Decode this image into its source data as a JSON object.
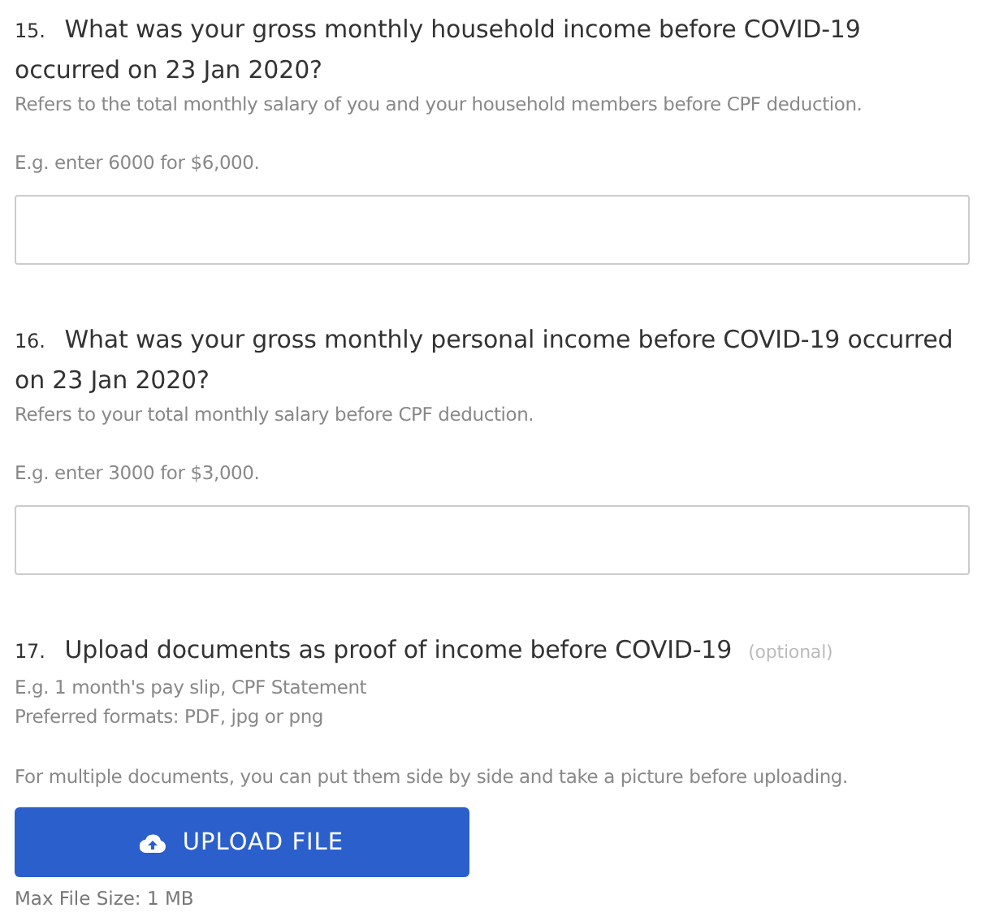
{
  "questions": [
    {
      "kind": "text",
      "number": "15.",
      "title": "What was your gross monthly household income before COVID-19 occurred on 23 Jan 2020?",
      "hints": [
        "Refers to the total monthly salary of you and your household members before CPF deduction."
      ],
      "example": "E.g. enter 6000 for $6,000."
    },
    {
      "kind": "text",
      "number": "16.",
      "title": "What was your gross monthly personal income before COVID-19 occurred on 23 Jan 2020?",
      "hints": [
        "Refers to your total monthly salary before CPF deduction."
      ],
      "example": "E.g. enter 3000 for $3,000."
    },
    {
      "kind": "upload",
      "number": "17.",
      "title": "Upload documents as proof of income before COVID-19",
      "optional": "(optional)",
      "hints": [
        "E.g. 1 month's pay slip, CPF Statement",
        "Preferred formats: PDF, jpg or png"
      ],
      "example": "For multiple documents, you can put them side by side and take a picture before uploading.",
      "button": "UPLOAD FILE",
      "note": "Max File Size: 1 MB"
    }
  ]
}
